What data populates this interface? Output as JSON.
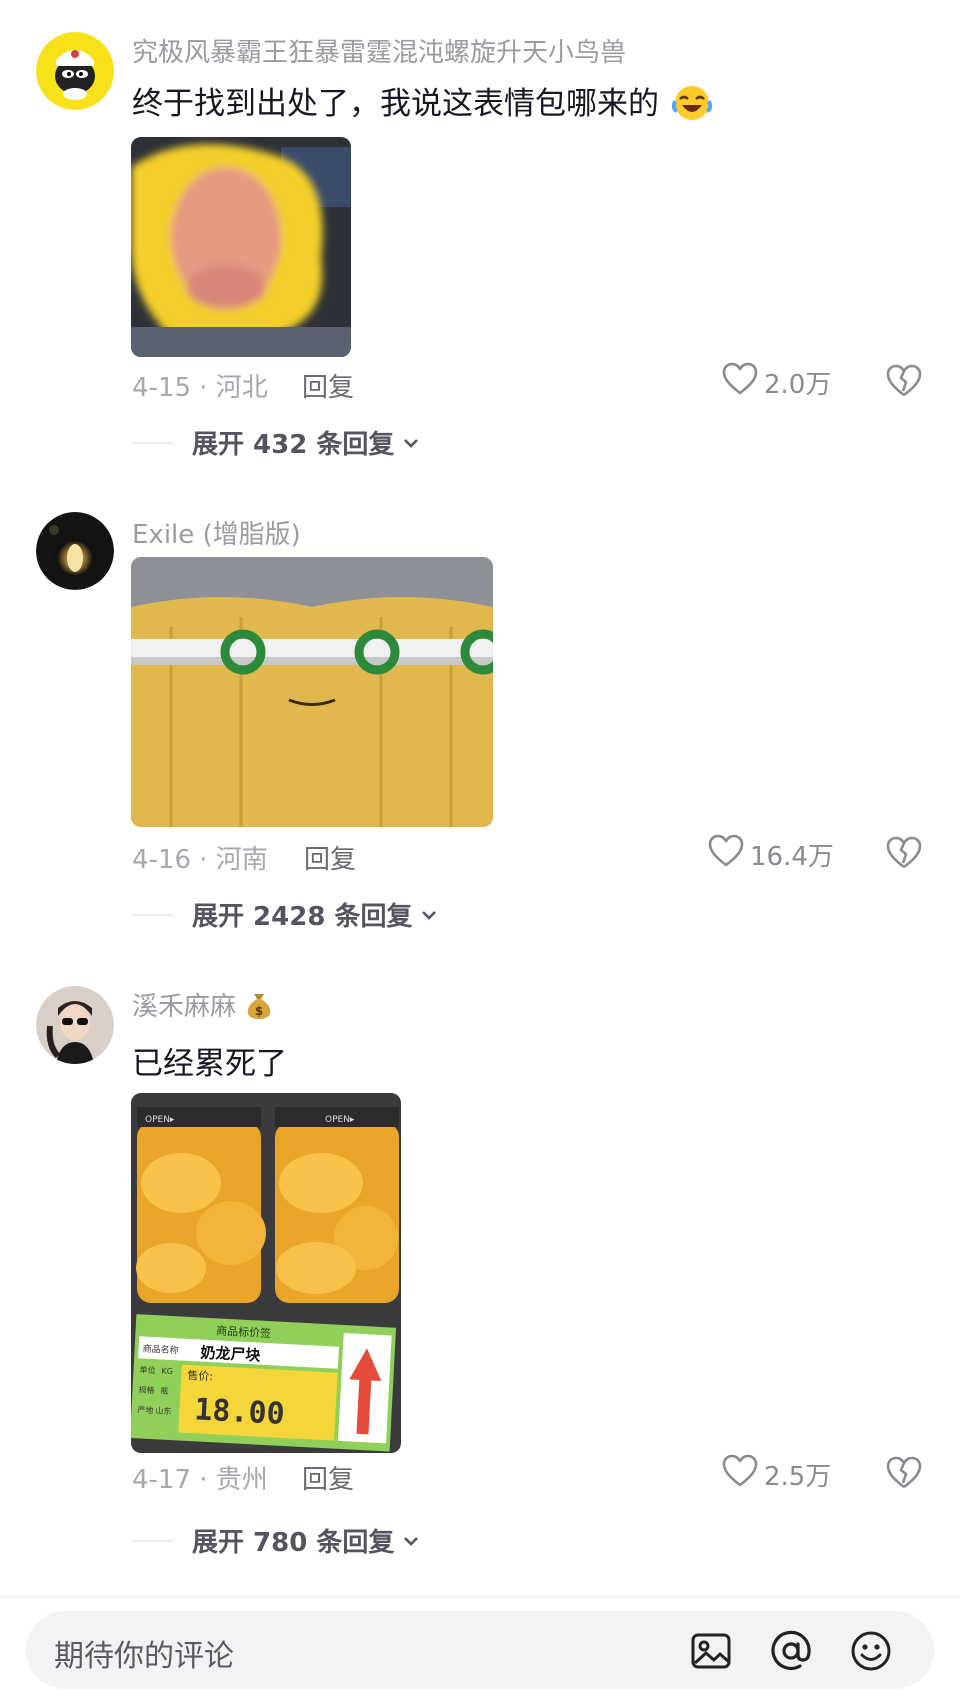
{
  "comments": [
    {
      "username": "究极风暴霸王狂暴雷霆混沌螺旋升天小鸟兽",
      "text": "终于找到出处了，我说这表情包哪来的",
      "text_emoji": "laughing-crying-emoji",
      "date_location": "4-15 · 河北",
      "reply_label": "回复",
      "likes": "2.0万",
      "expand_label": "展开 432 条回复"
    },
    {
      "username": "Exile (增脂版)",
      "date_location": "4-16 · 河南",
      "reply_label": "回复",
      "likes": "16.4万",
      "expand_label": "展开 2428 条回复"
    },
    {
      "username": "溪禾麻麻",
      "username_badge": "money-bag-icon",
      "text": "已经累死了",
      "date_location": "4-17 · 贵州",
      "reply_label": "回复",
      "likes": "2.5万",
      "expand_label": "展开 780 条回复",
      "image_text": {
        "tag_title": "商品标价签",
        "product_label": "商品名称",
        "product_name": "奶龙尸块",
        "unit_label": "单位",
        "unit_value": "KG",
        "price_label": "售价:",
        "price": "18.00",
        "spec_label": "规格",
        "spec_value": "瓶",
        "origin_label": "产地",
        "origin_value": "山东",
        "open_label": "OPEN▸"
      }
    }
  ],
  "input_bar": {
    "placeholder": "期待你的评论",
    "icons": [
      "image-icon",
      "at-icon",
      "emoji-icon"
    ]
  }
}
